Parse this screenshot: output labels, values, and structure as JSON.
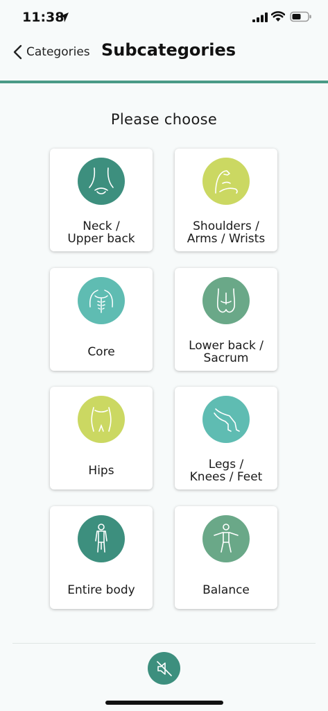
{
  "status": {
    "time": "11:38"
  },
  "nav": {
    "back_label": "Categories",
    "title": "Subcategories"
  },
  "prompt": "Please choose",
  "colors": {
    "accent": "#4a9a86",
    "dark_teal": "#3d8f7e",
    "lime": "#cbd862",
    "turquoise": "#5fbcb2",
    "sage": "#6aa888"
  },
  "tiles": [
    {
      "label": "Neck /\nUpper back",
      "icon": "neck-icon",
      "color": "#3d8f7e"
    },
    {
      "label": "Shoulders /\nArms / Wrists",
      "icon": "arm-icon",
      "color": "#cbd862"
    },
    {
      "label": "Core",
      "icon": "torso-icon",
      "color": "#5fbcb2"
    },
    {
      "label": "Lower back /\nSacrum",
      "icon": "lower-back-icon",
      "color": "#6aa888"
    },
    {
      "label": "Hips",
      "icon": "hips-icon",
      "color": "#cbd862"
    },
    {
      "label": "Legs /\nKnees / Feet",
      "icon": "legs-icon",
      "color": "#5fbcb2"
    },
    {
      "label": "Entire body",
      "icon": "body-icon",
      "color": "#3d8f7e"
    },
    {
      "label": "Balance",
      "icon": "balance-icon",
      "color": "#6aa888"
    }
  ],
  "footer": {
    "mute_icon": "speaker-muted-icon"
  }
}
